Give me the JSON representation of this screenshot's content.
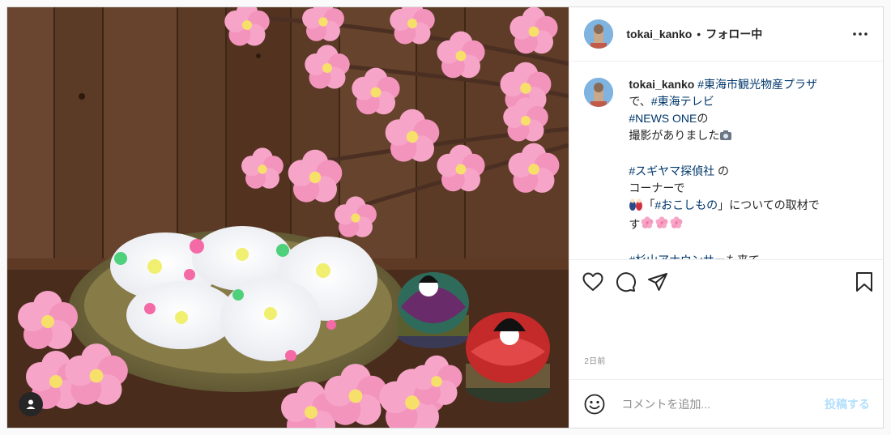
{
  "post": {
    "username": "tokai_kanko",
    "separator": "•",
    "follow_status": "フォロー中",
    "caption": {
      "username": "tokai_kanko",
      "segments": [
        {
          "text": " "
        },
        {
          "text": "#東海市観光物産プラザ",
          "tag": true
        },
        {
          "text": "\nで、"
        },
        {
          "text": "#東海テレビ",
          "tag": true
        },
        {
          "text": "\n"
        },
        {
          "text": "#NEWS ONE",
          "tag": true
        },
        {
          "text": "の\n撮影がありました"
        },
        {
          "emoji": "camera-emoji"
        },
        {
          "text": "\n\n"
        },
        {
          "text": "#スギヤマ探偵社",
          "tag": true
        },
        {
          "text": " の\nコーナーで\n"
        },
        {
          "emoji": "dolls-emoji"
        },
        {
          "text": "「"
        },
        {
          "text": "#おこしもの",
          "tag": true
        },
        {
          "text": "」についての取材で\nす"
        },
        {
          "emoji": "blossom-emoji"
        },
        {
          "emoji": "blossom-emoji"
        },
        {
          "emoji": "blossom-emoji"
        },
        {
          "text": "\n\n"
        },
        {
          "text": "#杉山アナウンサー",
          "tag": true
        },
        {
          "text": "も来て"
        }
      ]
    },
    "timestamp": "2日前"
  },
  "comment": {
    "placeholder": "コメントを追加...",
    "post_label": "投稿する"
  },
  "colors": {
    "link": "#00376b",
    "muted": "#8e8e8e",
    "post_disabled": "#b2dffc",
    "border": "#dbdbdb"
  }
}
